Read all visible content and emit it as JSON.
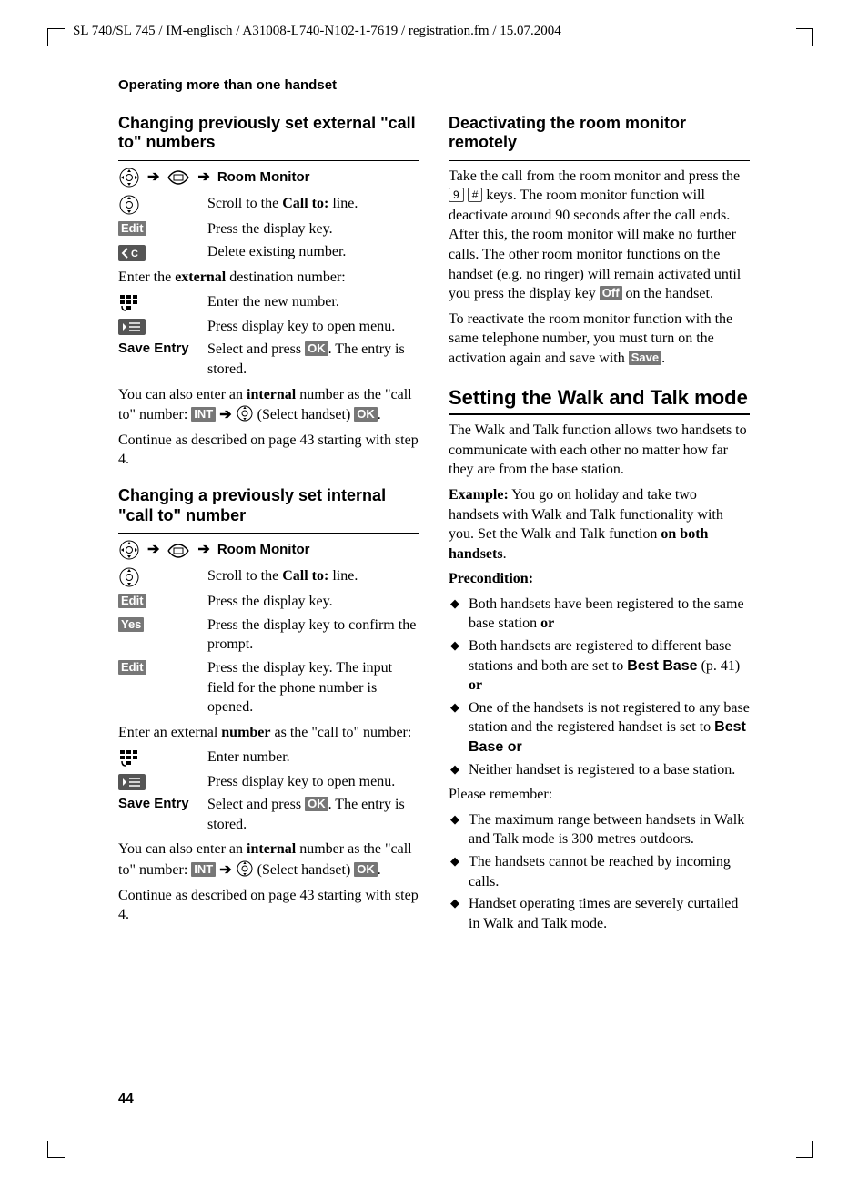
{
  "header": {
    "line": "SL 740/SL 745 / IM-englisch / A31008-L740-N102-1-7619 / registration.fm / 15.07.2004"
  },
  "section_title": "Operating more than one handset",
  "page_number": "44",
  "labels": {
    "arrow": "➔",
    "room_monitor": "Room Monitor",
    "edit": "Edit",
    "yes": "Yes",
    "ok": "OK",
    "off": "Off",
    "save": "Save",
    "int": "INT",
    "save_entry": "Save Entry",
    "key_9": "9",
    "key_hash": "#"
  },
  "left": {
    "h1": "Changing previously set external \"call to\" numbers",
    "scroll_call_to": "Scroll to the ",
    "call_to_bold": "Call to:",
    "line_suffix": " line.",
    "press_display_key": "Press the display key.",
    "delete_existing": "Delete existing number.",
    "enter_ext_prefix": "Enter the ",
    "external_bold": "external",
    "enter_ext_suffix": " destination number:",
    "enter_new_number": "Enter the new number.",
    "press_open_menu": "Press display key to open menu.",
    "save_entry_text_a": "Select and press ",
    "save_entry_text_b": ". The entry is stored.",
    "internal_note_a": "You can also enter an ",
    "internal_bold": "internal",
    "internal_note_b": " number as the \"call to\" number: ",
    "select_handset": " (Select handset) ",
    "continue_text": "Continue as described on page 43 starting with step 4.",
    "h2": "Changing a previously set internal \"call to\" number",
    "yes_text": "Press the display key to confirm the prompt.",
    "edit2_text": "Press the display key. The input field for the phone number is opened.",
    "enter_ext2_a": "Enter an external ",
    "number_bold": "number",
    "enter_ext2_b": " as the \"call to\" number:",
    "enter_number": "Enter number."
  },
  "right": {
    "h1": "Deactivating the room monitor remotely",
    "deact_para_a": "Take the call from the room monitor and press the ",
    "deact_para_b": " keys. The room monitor function will deactivate around 90 seconds after the call ends. After this, the room monitor will make no further calls. The other room monitor functions on the handset (e.g. no ringer) will remain activated until you press the display key ",
    "deact_para_c": " on the handset.",
    "react_para_a": "To reactivate the room monitor function with the same telephone number, you must turn on the activation again and save with ",
    "react_para_b": ".",
    "h2": "Setting the Walk and Talk mode",
    "walk_intro": "The Walk and Talk function allows two handsets to communicate with each other no matter how far they are from the base station.",
    "example_label": "Example:",
    "example_text_a": " You go on holiday and take two handsets with Walk and Talk functionality with you. Set the Walk and Talk function ",
    "on_both": "on both handsets",
    "example_text_b": ".",
    "precondition": "Precondition:",
    "pre_items": [
      {
        "a": "Both handsets have been registered to the same base station ",
        "b": "or"
      },
      {
        "a": "Both handsets are registered to different base stations and both are set to ",
        "bb": "Best Base",
        "c": " (p. 41) ",
        "b": "or"
      },
      {
        "a": "One of the handsets is not registered to any base station and the registered handset is set to ",
        "bb": "Best Base or"
      },
      {
        "a": "Neither handset is registered to a base station."
      }
    ],
    "remember": "Please remember:",
    "rem_items": [
      "The maximum range between handsets in Walk and Talk mode is 300 metres outdoors.",
      "The handsets cannot be reached by incoming calls.",
      "Handset operating times are severely curtailed in Walk and Talk mode."
    ]
  }
}
